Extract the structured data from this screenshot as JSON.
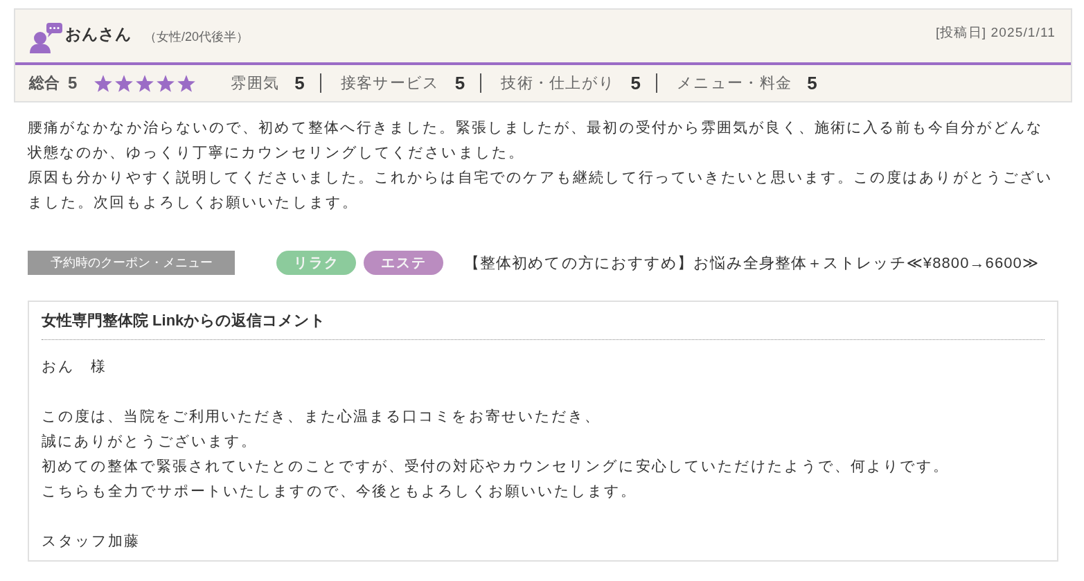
{
  "review": {
    "reviewer": {
      "name": "おんさん",
      "profile": "（女性/20代後半）"
    },
    "posted": "[投稿日] 2025/1/11",
    "overall": {
      "label": "総合",
      "score": "5",
      "stars": 5
    },
    "ratings": [
      {
        "label": "雰囲気",
        "score": "5"
      },
      {
        "label": "接客サービス",
        "score": "5"
      },
      {
        "label": "技術・仕上がり",
        "score": "5"
      },
      {
        "label": "メニュー・料金",
        "score": "5"
      }
    ],
    "body": [
      "腰痛がなかなか治らないので、初めて整体へ行きました。緊張しましたが、最初の受付から雰囲気が良く、施術に入る前も今自分がどんな状態なのか、ゆっくり丁寧にカウンセリングしてくださいました。",
      "原因も分かりやすく説明してくださいました。これからは自宅でのケアも継続して行っていきたいと思います。この度はありがとうございました。次回もよろしくお願いいたします。"
    ],
    "coupon": {
      "label": "予約時のクーポン・メニュー",
      "tags": [
        {
          "label": "リラク",
          "color": "#8ccb9c"
        },
        {
          "label": "エステ",
          "color": "#ba8cc0"
        }
      ],
      "menu": "【整体初めての方におすすめ】お悩み全身整体＋ストレッチ≪¥8800→6600≫"
    }
  },
  "reply": {
    "title": "女性専門整体院 Linkからの返信コメント",
    "paragraphs": [
      {
        "lines": [
          "おん　様"
        ]
      },
      {
        "lines": [
          "この度は、当院をご利用いただき、また心温まる口コミをお寄せいただき、",
          "誠にありがとうございます。",
          "初めての整体で緊張されていたとのことですが、受付の対応やカウンセリングに安心していただけたようで、何よりです。",
          "こちらも全力でサポートいたしますので、今後ともよろしくお願いいたします。"
        ]
      },
      {
        "lines": [
          "スタッフ加藤"
        ]
      }
    ]
  }
}
